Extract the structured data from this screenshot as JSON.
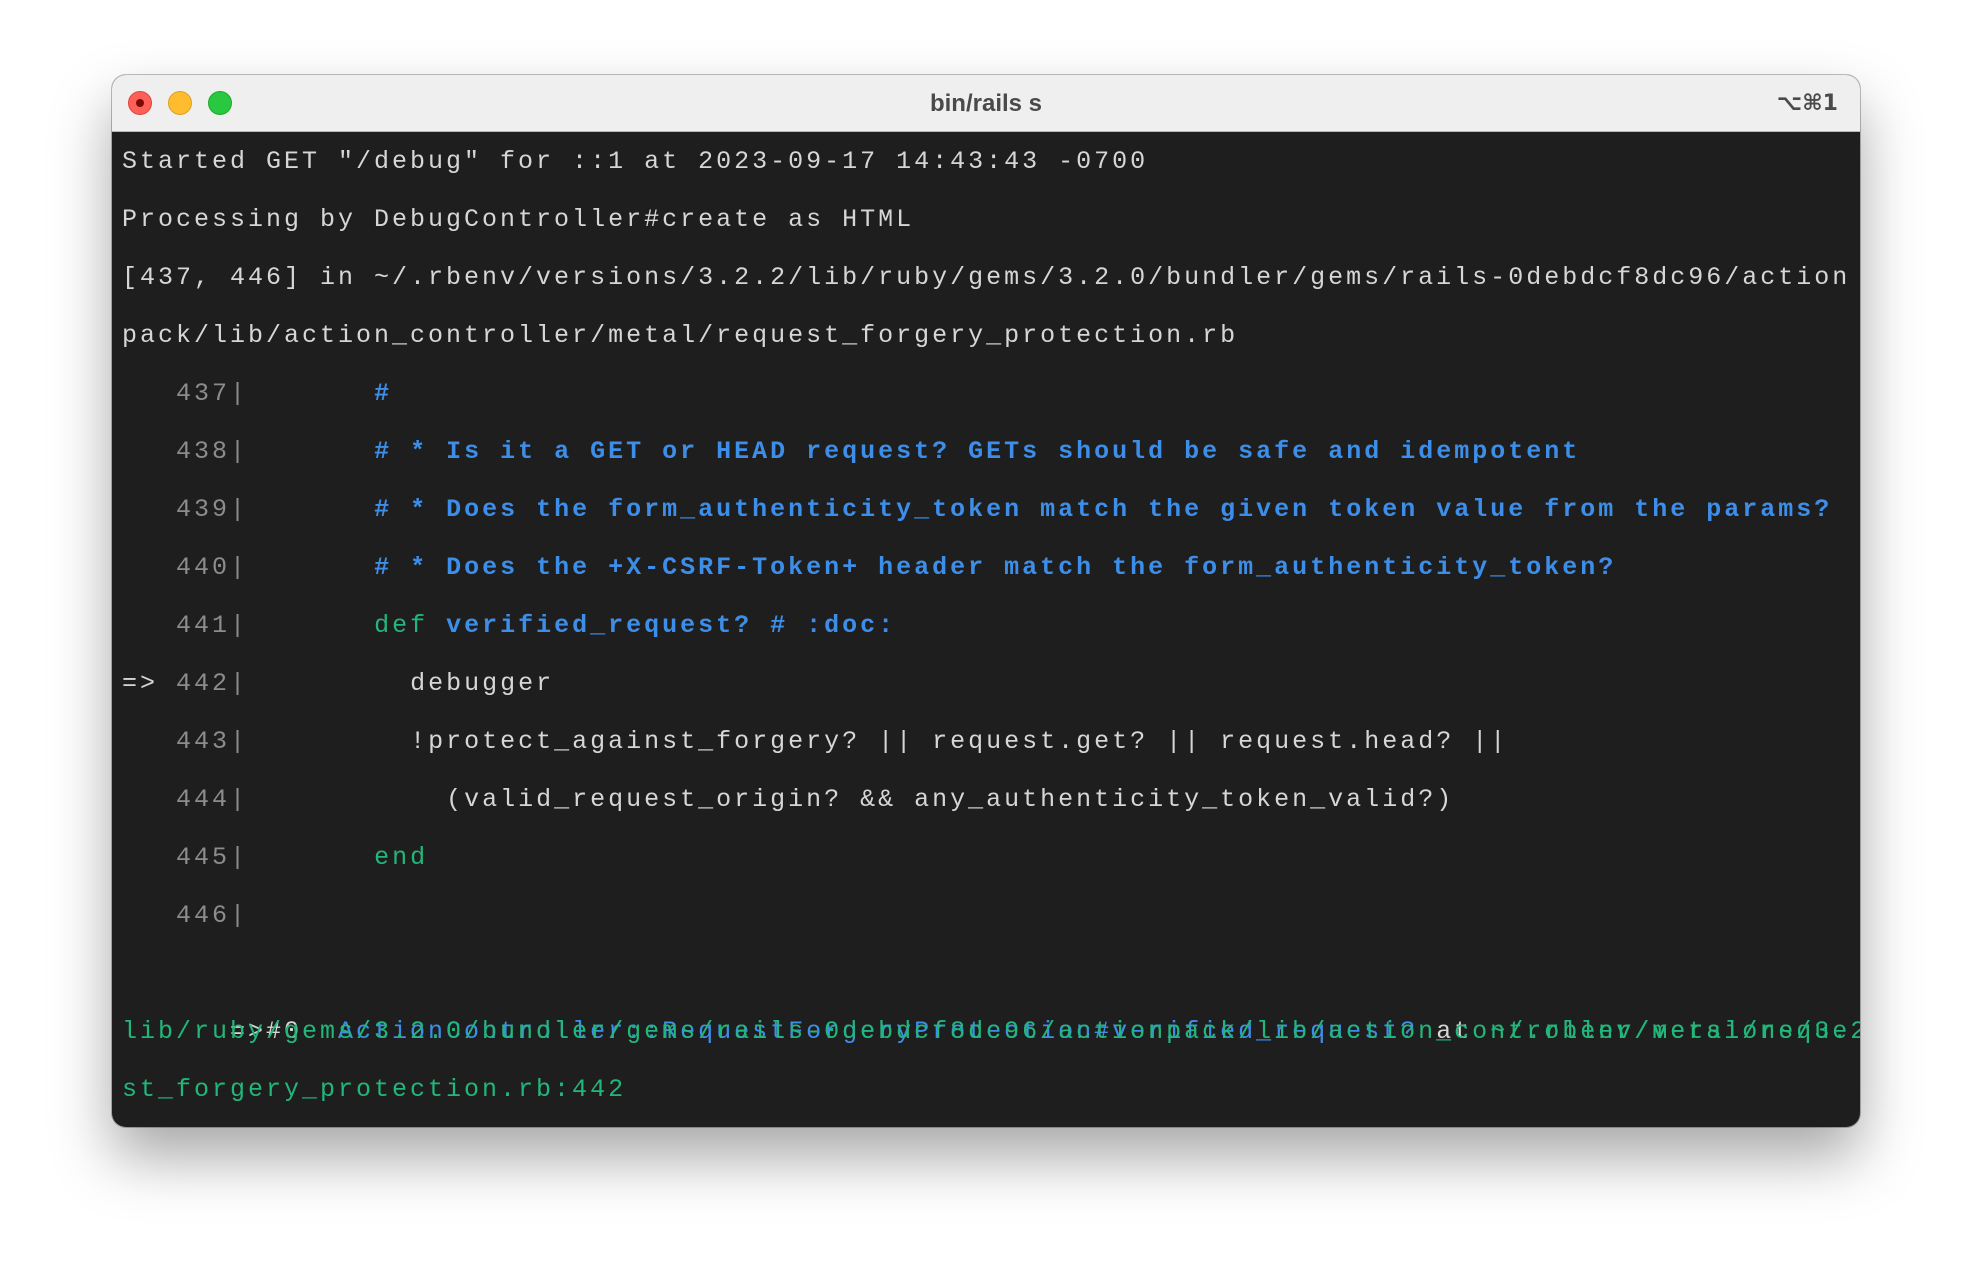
{
  "window": {
    "title": "bin/rails s",
    "shortcut": "⌥⌘1",
    "controls": [
      "close",
      "minimize",
      "zoom"
    ]
  },
  "colors": {
    "background": "#1e1e1e",
    "text": "#d6d6d6",
    "line_number": "#8c8c8c",
    "comment": "#3d8ee9",
    "keyword": "#22b77a",
    "path": "#22b77a"
  },
  "log": {
    "started": "Started GET \"/debug\" for ::1 at 2023-09-17 14:43:43 -0700",
    "processing": "Processing by DebugController#create as HTML",
    "range_line1": "[437, 446] in ~/.rbenv/versions/3.2.2/lib/ruby/gems/3.2.0/bundler/gems/rails-0debdcf8dc96/action",
    "range_line2": "pack/lib/action_controller/metal/request_forgery_protection.rb"
  },
  "source": {
    "lines": [
      {
        "marker": "   ",
        "number": "437|",
        "indent": "       ",
        "segments": [
          {
            "text": "#",
            "style": "comment"
          }
        ]
      },
      {
        "marker": "   ",
        "number": "438|",
        "indent": "       ",
        "segments": [
          {
            "text": "# * Is it a GET or HEAD request? GETs should be safe and idempotent",
            "style": "comment"
          }
        ]
      },
      {
        "marker": "   ",
        "number": "439|",
        "indent": "       ",
        "segments": [
          {
            "text": "# * Does the form_authenticity_token match the given token value from the params?",
            "style": "comment"
          }
        ]
      },
      {
        "marker": "   ",
        "number": "440|",
        "indent": "       ",
        "segments": [
          {
            "text": "# * Does the +X-CSRF-Token+ header match the form_authenticity_token?",
            "style": "comment"
          }
        ]
      },
      {
        "marker": "   ",
        "number": "441|",
        "indent": "       ",
        "segments": [
          {
            "text": "def",
            "style": "keyword"
          },
          {
            "text": " verified_request? # :doc:",
            "style": "comment"
          }
        ]
      },
      {
        "marker": "=> ",
        "number": "442|",
        "indent": "         ",
        "segments": [
          {
            "text": "debugger",
            "style": "plain"
          }
        ]
      },
      {
        "marker": "   ",
        "number": "443|",
        "indent": "         ",
        "segments": [
          {
            "text": "!protect_against_forgery? || request.get? || request.head? ||",
            "style": "plain"
          }
        ]
      },
      {
        "marker": "   ",
        "number": "444|",
        "indent": "           ",
        "segments": [
          {
            "text": "(valid_request_origin? && any_authenticity_token_valid?)",
            "style": "plain"
          }
        ]
      },
      {
        "marker": "   ",
        "number": "445|",
        "indent": "       ",
        "segments": [
          {
            "text": "end",
            "style": "keyword"
          }
        ]
      },
      {
        "marker": "   ",
        "number": "446|",
        "indent": "",
        "segments": []
      }
    ]
  },
  "frame": {
    "prefix": "=>#0  ",
    "method": "ActionController::RequestForgeryProtection#verified_request?",
    "at": " at ",
    "location_line1": "~/.rbenv/versions/3.2.2/",
    "location_line2": "lib/ruby/gems/3.2.0/bundler/gems/rails-0debdcf8dc96/actionpack/lib/action_controller/metal/reque",
    "location_line3": "st_forgery_protection.rb:442"
  }
}
